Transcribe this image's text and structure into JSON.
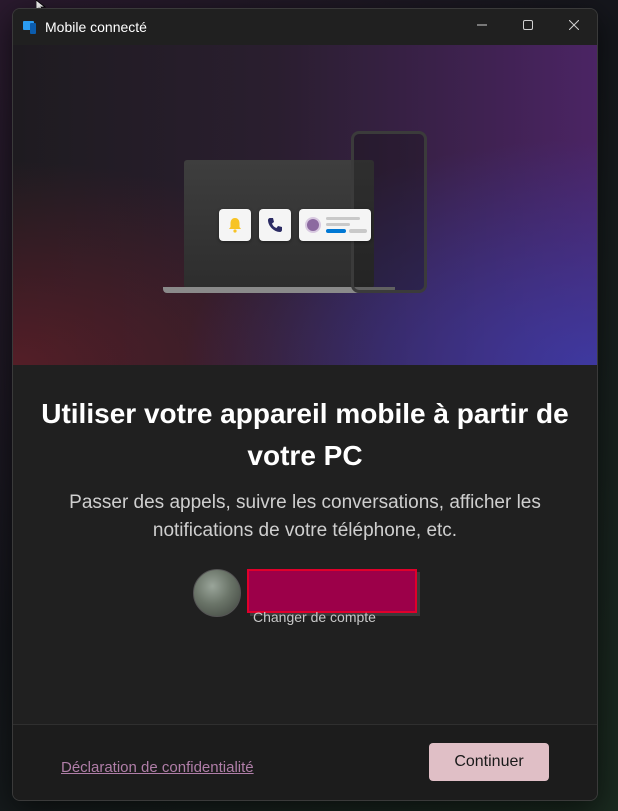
{
  "window": {
    "title": "Mobile connecté"
  },
  "hero": {
    "icons": [
      "bell-icon",
      "phone-call-icon",
      "message-icon"
    ],
    "colors": {
      "bell": "#f7c325",
      "call": "#2b2b63",
      "accent": "#0078d4"
    }
  },
  "main": {
    "heading": "Utiliser votre appareil mobile à partir de votre PC",
    "subtext": "Passer des appels, suivre les conversations, afficher les notifications de votre téléphone, etc."
  },
  "account": {
    "change_label": "Changer de compte",
    "redaction_color": "#9c0049"
  },
  "footer": {
    "privacy_label": "Déclaration de confidentialité",
    "continue_label": "Continuer",
    "continue_color": "#e0bfc6"
  }
}
